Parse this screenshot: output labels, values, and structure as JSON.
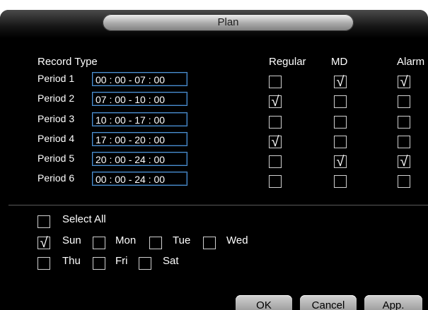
{
  "window": {
    "title": "Plan"
  },
  "columns": {
    "record_type": "Record Type",
    "regular": "Regular",
    "md": "MD",
    "alarm": "Alarm"
  },
  "periods": [
    {
      "label": "Period 1",
      "time": "00 : 00 - 07 : 00",
      "regular": false,
      "md": true,
      "alarm": true
    },
    {
      "label": "Period 2",
      "time": "07 : 00 - 10 : 00",
      "regular": true,
      "md": false,
      "alarm": false
    },
    {
      "label": "Period 3",
      "time": "10 : 00 - 17 : 00",
      "regular": false,
      "md": false,
      "alarm": false
    },
    {
      "label": "Period 4",
      "time": "17 : 00 - 20 : 00",
      "regular": true,
      "md": false,
      "alarm": false
    },
    {
      "label": "Period 5",
      "time": "20 : 00 - 24 : 00",
      "regular": false,
      "md": true,
      "alarm": true
    },
    {
      "label": "Period 6",
      "time": "00 : 00 - 24 : 00",
      "regular": false,
      "md": false,
      "alarm": false
    }
  ],
  "days": {
    "select_all": {
      "label": "Select All",
      "checked": false
    },
    "sun": {
      "label": "Sun",
      "checked": true
    },
    "mon": {
      "label": "Mon",
      "checked": false
    },
    "tue": {
      "label": "Tue",
      "checked": false
    },
    "wed": {
      "label": "Wed",
      "checked": false
    },
    "thu": {
      "label": "Thu",
      "checked": false
    },
    "fri": {
      "label": "Fri",
      "checked": false
    },
    "sat": {
      "label": "Sat",
      "checked": false
    }
  },
  "buttons": {
    "ok": "OK",
    "cancel": "Cancel",
    "apply": "App."
  },
  "check_glyph": "√"
}
